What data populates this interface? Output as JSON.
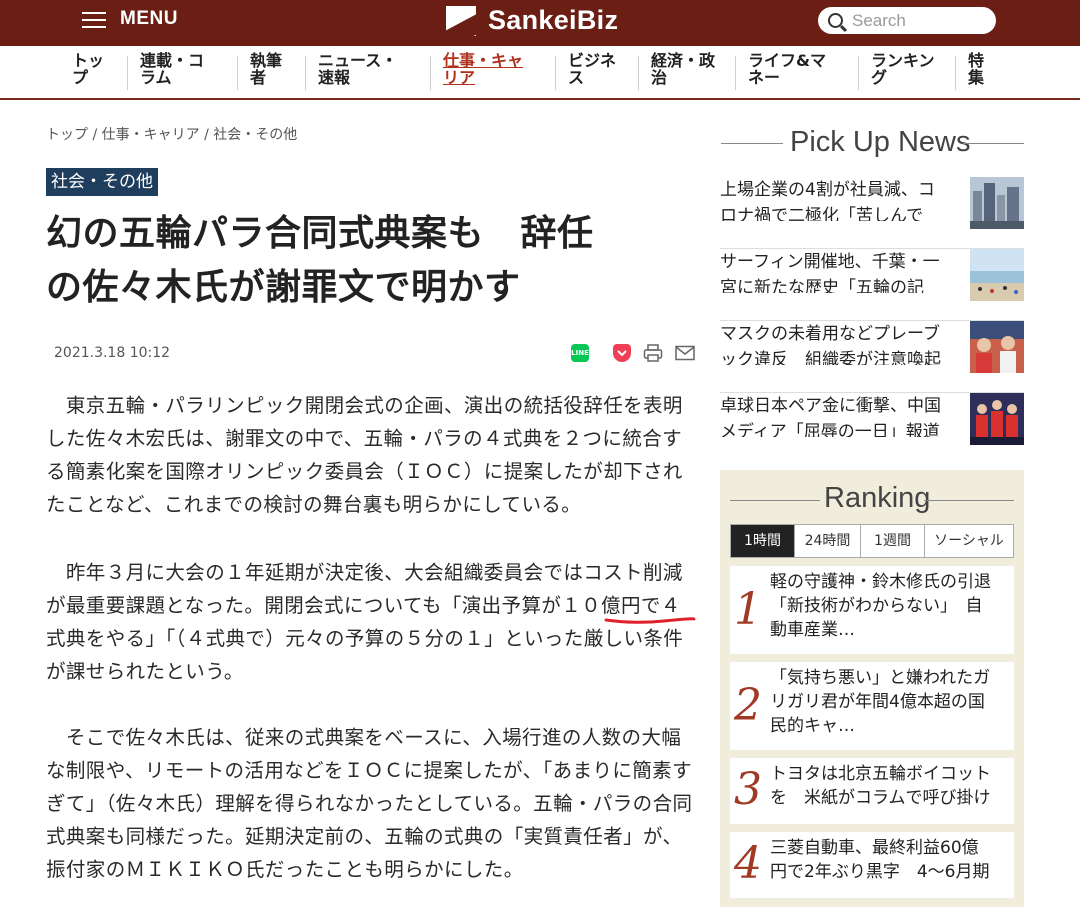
{
  "header": {
    "menu_label": "MENU",
    "logo_text": "SankeiBiz",
    "search_placeholder": "Search",
    "brand_color": "#6b1f14"
  },
  "nav": {
    "items": [
      {
        "label": "トッ\nプ"
      },
      {
        "label": "連載・コ\nラム"
      },
      {
        "label": "執筆\n者"
      },
      {
        "label": "ニュース・\n速報"
      },
      {
        "label": "仕事・キャ\nリア",
        "active": true
      },
      {
        "label": "ビジネ\nス"
      },
      {
        "label": "経済・政\n治"
      },
      {
        "label": "ライフ&マ\nネー"
      },
      {
        "label": "ランキン\nグ"
      },
      {
        "label": "特\n集"
      }
    ]
  },
  "breadcrumb": [
    "トップ",
    " / ",
    "仕事・キャリア",
    " / ",
    "社会・その他"
  ],
  "article": {
    "category": "社会・その他",
    "headline_line1": "幻の五輪パラ合同式典案も　辞任",
    "headline_line2": "の佐々木氏が謝罪文で明かす",
    "date": "2021.3.18 10:12",
    "share": {
      "line": "LINE"
    },
    "paragraphs": [
      "　東京五輪・パラリンピック開閉会式の企画、演出の統括役辞任を表明した佐々木宏氏は、謝罪文の中で、五輪・パラの４式典を２つに統合する簡素化案を国際オリンピック委員会（ＩＯＣ）に提案したが却下されたことなど、これまでの検討の舞台裏も明らかにしている。",
      "　昨年３月に大会の１年延期が決定後、大会組織委員会ではコスト削減が最重要課題となった。開閉会式についても「演出予算が１０億円で４式典をやる」「（４式典で）元々の予算の５分の１」といった厳しい条件が課せられたという。",
      "　そこで佐々木氏は、従来の式典案をベースに、入場行進の人数の大幅な制限や、リモートの活用などをＩＯＣに提案したが、「あまりに簡素すぎて」（佐々木氏）理解を得られなかったとしている。五輪・パラの合同式典案も同様だった。延期決定前の、五輪の式典の「実質責任者」が、振付家のＭＩＫＩＫＯ氏だったことも明らかにした。"
    ]
  },
  "pickup": {
    "title": "Pick Up News",
    "items": [
      {
        "line1": "上場企業の4割が社員減、コ",
        "line2": "ロナ禍で二極化「苦しんで"
      },
      {
        "line1": "サーフィン開催地、千葉・一",
        "line2": "宮に新たな歴史「五輪の記"
      },
      {
        "line1": "マスクの未着用などプレーブ",
        "line2": "ック違反　組織委が注意喚起"
      },
      {
        "line1": "卓球日本ペア金に衝撃、中国",
        "line2": "メディア「屈辱の一日」報道"
      }
    ]
  },
  "ranking": {
    "title": "Ranking",
    "tabs": [
      "1時間",
      "24時間",
      "1週間",
      "ソーシャル"
    ],
    "items": [
      {
        "rank": "1",
        "line1": "軽の守護神・鈴木修氏の引退",
        "line2": "「新技術がわからない」　自",
        "line3": "動車産業…"
      },
      {
        "rank": "2",
        "line1": "「気持ち悪い」と嫌われたガ",
        "line2": "リガリ君が年間4億本超の国",
        "line3": "民的キャ…"
      },
      {
        "rank": "3",
        "line1": "トヨタは北京五輪ボイコット",
        "line2": "を　米紙がコラムで呼び掛け",
        "line3": ""
      },
      {
        "rank": "4",
        "line1": "三菱自動車、最終利益60億",
        "line2": "円で2年ぶり黒字　4〜6月期",
        "line3": ""
      }
    ]
  }
}
